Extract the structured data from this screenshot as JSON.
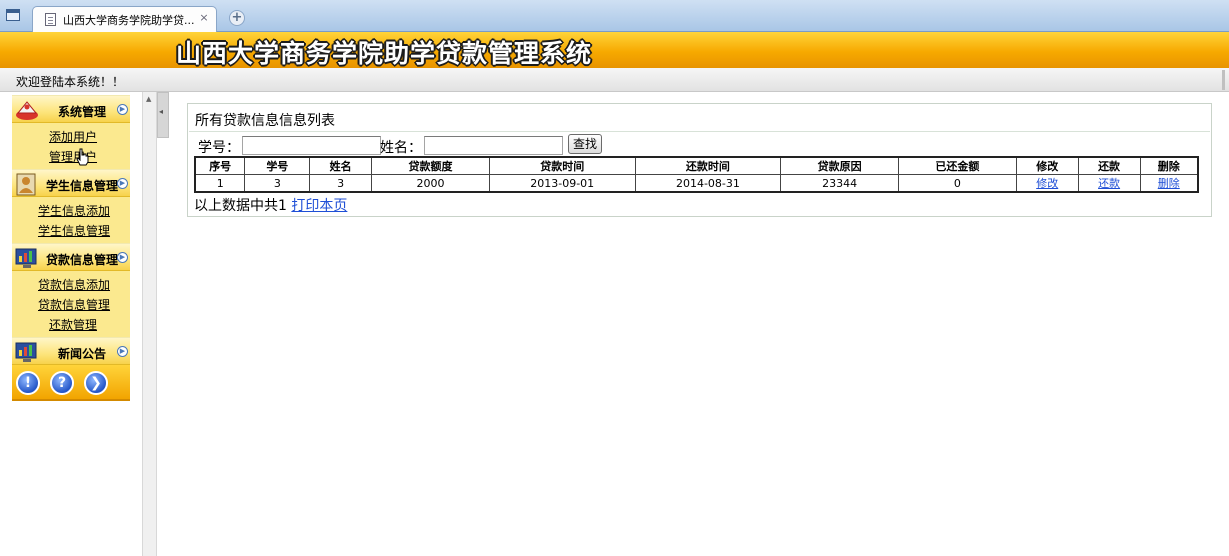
{
  "browser": {
    "tab_title": "山西大学商务学院助学贷...",
    "tab_close": "×",
    "new_tab": "+"
  },
  "header": {
    "title": "山西大学商务学院助学贷款管理系统"
  },
  "welcome": {
    "text": "欢迎登陆本系统！！"
  },
  "sidebar": {
    "menus": [
      {
        "title": "系统管理",
        "icon": "cake-icon",
        "items": [
          "添加用户",
          "管理用户"
        ]
      },
      {
        "title": "学生信息管理",
        "icon": "person-icon",
        "items": [
          "学生信息添加",
          "学生信息管理"
        ]
      },
      {
        "title": "贷款信息管理",
        "icon": "monitor-chart-icon",
        "items": [
          "贷款信息添加",
          "贷款信息管理",
          "还款管理"
        ]
      },
      {
        "title": "新闻公告",
        "icon": "monitor-chart-icon",
        "items": []
      }
    ],
    "bottom_buttons": [
      {
        "icon": "info-icon",
        "glyph": "!"
      },
      {
        "icon": "help-icon",
        "glyph": "?"
      },
      {
        "icon": "forward-icon",
        "glyph": "❯"
      }
    ]
  },
  "main": {
    "panel_title": "所有贷款信息信息列表",
    "search": {
      "student_no_label": "学号：",
      "student_no_value": "",
      "name_label": "姓名：",
      "name_value": "",
      "button": "查找"
    },
    "table": {
      "columns": [
        "序号",
        "学号",
        "姓名",
        "贷款额度",
        "贷款时间",
        "还款时间",
        "贷款原因",
        "已还金额",
        "修改",
        "还款",
        "删除"
      ],
      "rows": [
        [
          "1",
          "3",
          "3",
          "2000",
          "2013-09-01",
          "2014-08-31",
          "23344",
          "0",
          "修改",
          "还款",
          "删除"
        ]
      ]
    },
    "footer": {
      "summary": "以上数据中共1",
      "print_link": "打印本页"
    }
  },
  "colors": {
    "banner_top": "#ffd43a",
    "banner_bottom": "#e89400",
    "menu_bg": "#fbe98f",
    "link": "#1f4fd6"
  }
}
